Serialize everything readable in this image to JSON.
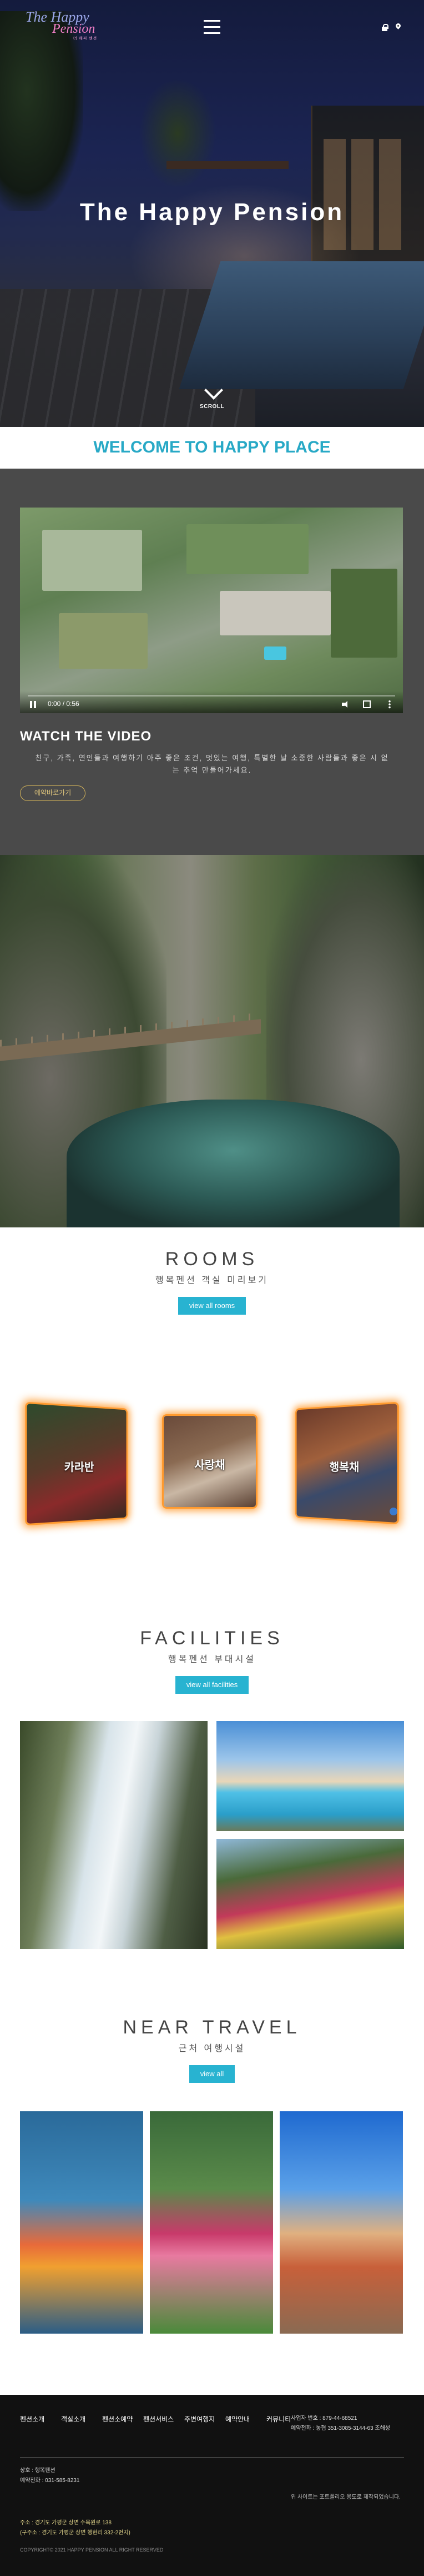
{
  "brand": {
    "logo_line1": "The Happy",
    "logo_line2": "Pension",
    "logo_line3": "더 해피 펜션"
  },
  "hero": {
    "title": "The Happy Pension",
    "scroll_label": "SCROLL"
  },
  "welcome": {
    "heading": "WELCOME TO HAPPY PLACE"
  },
  "video": {
    "time": "0:00 / 0:56",
    "progress": 0.0,
    "title": "WATCH THE VIDEO",
    "description": "친구, 가족, 연인들과 여행하기 아주 좋은 조건, 멋있는 여행, 특별한 날 소중한 사람들과 좋은 시 없는 추억 만들어가세요.",
    "button": "예약바로가기"
  },
  "rooms": {
    "heading": "ROOMS",
    "subheading": "행복펜션 객실 미리보기",
    "button": "view all rooms",
    "cards": [
      {
        "label": "카라반"
      },
      {
        "label": "사랑채"
      },
      {
        "label": "행복채"
      }
    ]
  },
  "facilities": {
    "heading": "FACILITIES",
    "subheading": "행복펜션 부대시설",
    "button": "view all facilities"
  },
  "near": {
    "heading": "NEAR TRAVEL",
    "subheading": "근처 여행시설",
    "button": "view all"
  },
  "footer": {
    "nav": [
      "펜션소개",
      "객실소개",
      "펜션소예약",
      "펜션서비스",
      "주변여행지",
      "예약안내",
      "커뮤니티"
    ],
    "left_lines": [
      "상호 : 행복펜션",
      "예약전화 : 031-585-8231"
    ],
    "right_lines": [
      "사업자 번호 : 879-44-68521",
      "예약전화 : 농협 351-3085-3144-63 조해성"
    ],
    "right_note": "위 사이트는 포트폴리오 용도로 제작되었습니다.",
    "address1": "주소 : 경기도 가평군 상면 수목원로 138",
    "address2": "(구주소 : 경기도 가평군 상면 행현리 332-2번지)",
    "copyright": "COPYRIGHT© 2021 HAPPY PENSION ALL RIGHT RESERVED"
  }
}
